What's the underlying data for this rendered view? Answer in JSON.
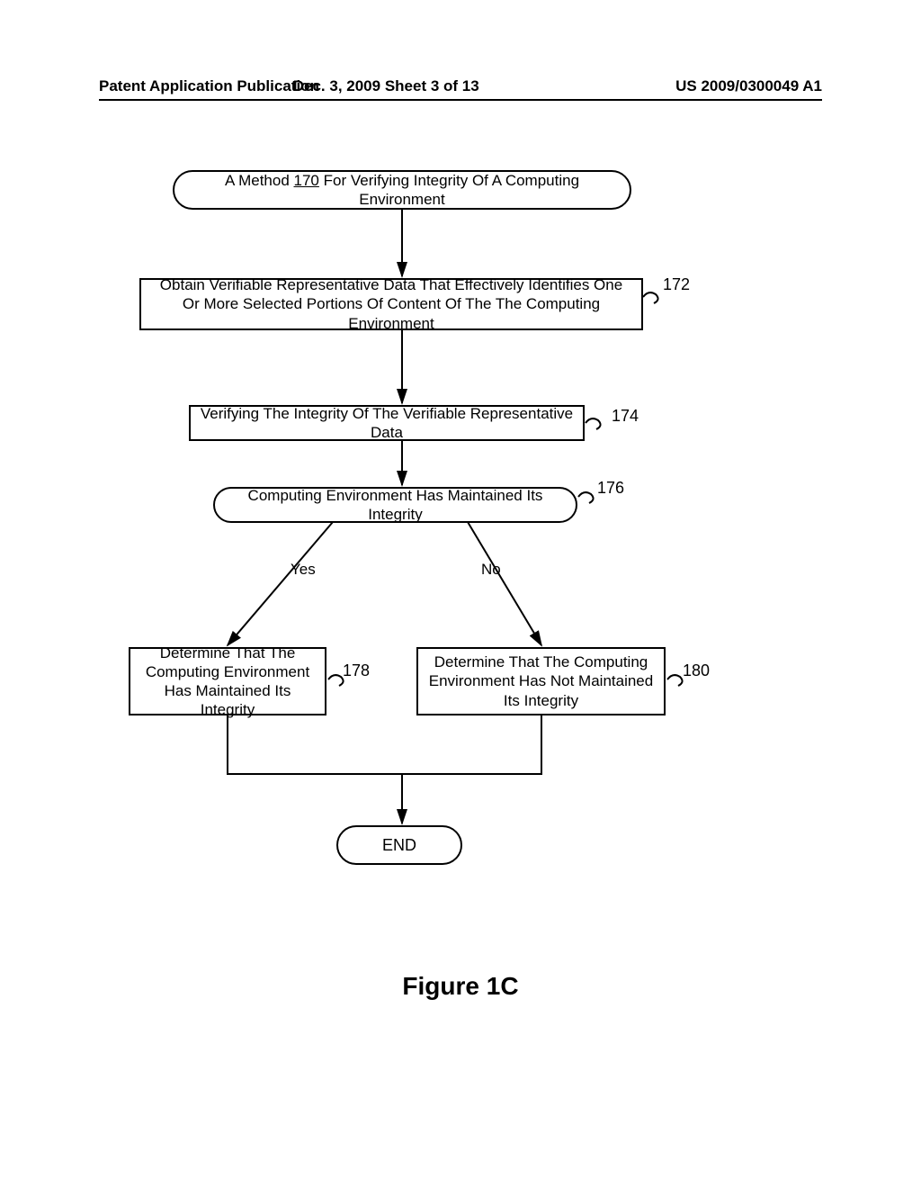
{
  "header": {
    "left": "Patent Application Publication",
    "center": "Dec. 3, 2009  Sheet 3 of 13",
    "right": "US 2009/0300049 A1"
  },
  "nodes": {
    "title_prefix": "A Method ",
    "title_num": "170",
    "title_suffix": " For Verifying Integrity Of A Computing Environment",
    "step172": "Obtain Verifiable Representative  Data That Effectively Identifies One Or More Selected Portions Of Content Of The The Computing Environment",
    "step174": "Verifying The Integrity Of The Verifiable Representative Data",
    "decision176": "Computing Environment Has Maintained Its Integrity",
    "step178": "Determine That The Computing Environment Has Maintained Its Integrity",
    "step180": "Determine That The Computing Environment Has Not Maintained Its Integrity",
    "end": "END"
  },
  "refs": {
    "r172": "172",
    "r174": "174",
    "r176": "176",
    "r178": "178",
    "r180": "180"
  },
  "branches": {
    "yes": "Yes",
    "no": "No"
  },
  "caption": "Figure 1C"
}
